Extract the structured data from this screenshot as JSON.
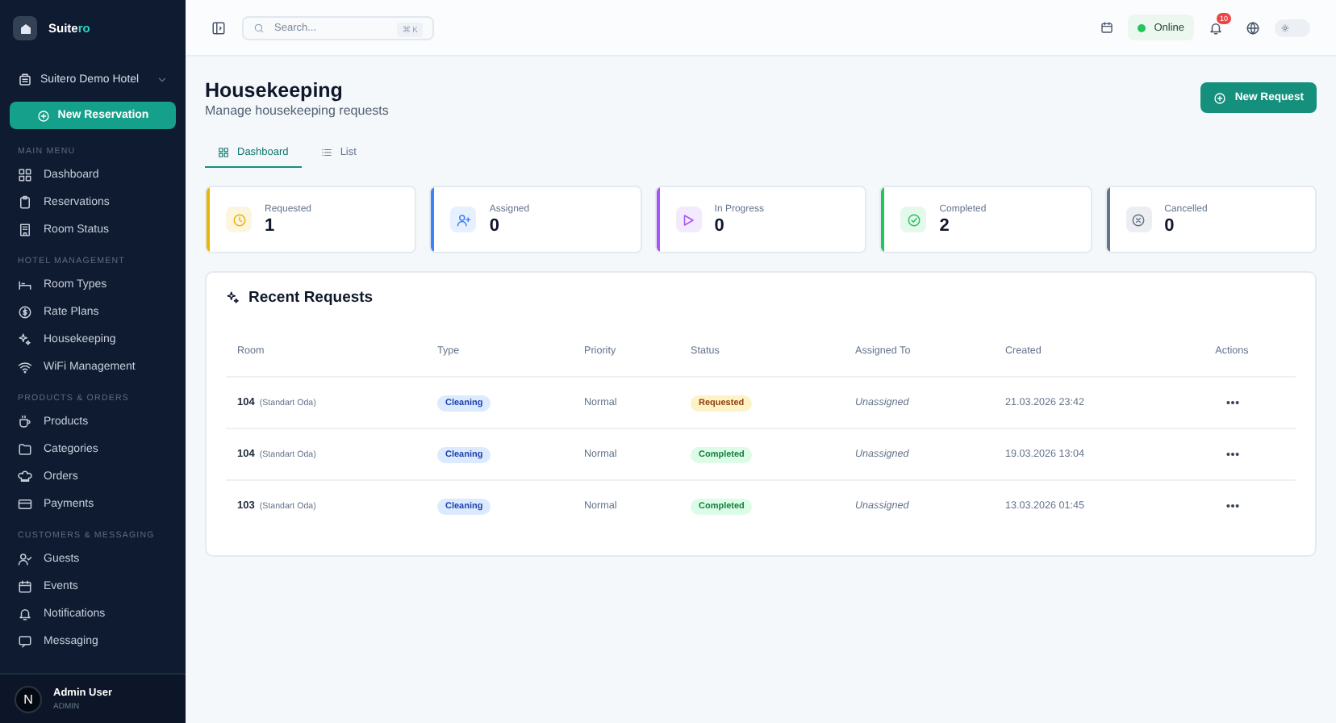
{
  "sidebar": {
    "brand": {
      "main": "Suite",
      "accent": "ro"
    },
    "hotel": "Suitero Demo Hotel",
    "new_button": "New Reservation",
    "sections": [
      {
        "title": "MAIN MENU",
        "items": [
          "Dashboard",
          "Reservations",
          "Room Status"
        ]
      },
      {
        "title": "HOTEL MANAGEMENT",
        "items": [
          "Room Types",
          "Rate Plans",
          "Housekeeping",
          "WiFi Management"
        ]
      },
      {
        "title": "PRODUCTS & ORDERS",
        "items": [
          "Products",
          "Categories",
          "Orders",
          "Payments"
        ]
      },
      {
        "title": "CUSTOMERS & MESSAGING",
        "items": [
          "Guests",
          "Events",
          "Notifications",
          "Messaging"
        ]
      }
    ],
    "user": {
      "initial": "N",
      "name": "Admin User",
      "role": "ADMIN"
    }
  },
  "topbar": {
    "search": {
      "placeholder": "Search...",
      "shortcut": "⌘ K"
    },
    "status": {
      "label": "Online",
      "online": true
    },
    "notifications": "10",
    "dark_mode": false
  },
  "page": {
    "title": "Housekeeping",
    "subtitle": "Manage housekeeping requests",
    "action": "New Request"
  },
  "tabs": [
    {
      "label": "Dashboard",
      "selected": true
    },
    {
      "label": "List",
      "selected": false
    }
  ],
  "stats": [
    {
      "label": "Requested",
      "value": "1",
      "color": "#eab308"
    },
    {
      "label": "Assigned",
      "value": "0",
      "color": "#3b82f6"
    },
    {
      "label": "In Progress",
      "value": "0",
      "color": "#a855f7"
    },
    {
      "label": "Completed",
      "value": "2",
      "color": "#22c55e"
    },
    {
      "label": "Cancelled",
      "value": "0",
      "color": "#64748b"
    }
  ],
  "recent": {
    "title": "Recent Requests",
    "columns": [
      "Room",
      "Type",
      "Priority",
      "Status",
      "Assigned To",
      "Created",
      "Actions"
    ],
    "rows": [
      {
        "room": "104",
        "room_type": "(Standart Oda)",
        "type": "Cleaning",
        "priority": "Normal",
        "status": {
          "label": "Requested",
          "kind": "requested"
        },
        "assigned": "Unassigned",
        "created": "21.03.2026 23:42"
      },
      {
        "room": "104",
        "room_type": "(Standart Oda)",
        "type": "Cleaning",
        "priority": "Normal",
        "status": {
          "label": "Completed",
          "kind": "completed"
        },
        "assigned": "Unassigned",
        "created": "19.03.2026 13:04"
      },
      {
        "room": "103",
        "room_type": "(Standart Oda)",
        "type": "Cleaning",
        "priority": "Normal",
        "status": {
          "label": "Completed",
          "kind": "completed"
        },
        "assigned": "Unassigned",
        "created": "13.03.2026 01:45"
      }
    ]
  }
}
